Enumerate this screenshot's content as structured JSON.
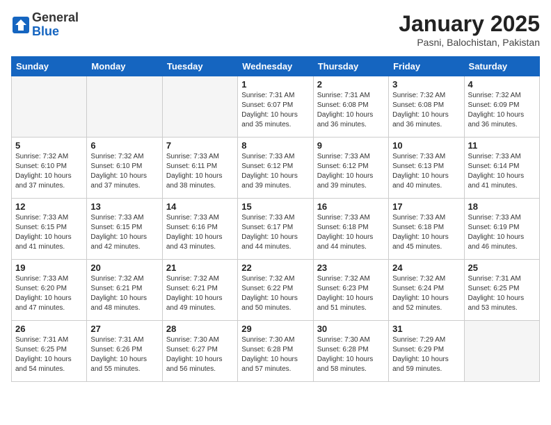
{
  "header": {
    "logo_line1": "General",
    "logo_line2": "Blue",
    "title": "January 2025",
    "subtitle": "Pasni, Balochistan, Pakistan"
  },
  "weekdays": [
    "Sunday",
    "Monday",
    "Tuesday",
    "Wednesday",
    "Thursday",
    "Friday",
    "Saturday"
  ],
  "weeks": [
    [
      {
        "day": "",
        "empty": true
      },
      {
        "day": "",
        "empty": true
      },
      {
        "day": "",
        "empty": true
      },
      {
        "day": "1",
        "sunrise": "7:31 AM",
        "sunset": "6:07 PM",
        "daylight": "10 hours and 35 minutes."
      },
      {
        "day": "2",
        "sunrise": "7:31 AM",
        "sunset": "6:08 PM",
        "daylight": "10 hours and 36 minutes."
      },
      {
        "day": "3",
        "sunrise": "7:32 AM",
        "sunset": "6:08 PM",
        "daylight": "10 hours and 36 minutes."
      },
      {
        "day": "4",
        "sunrise": "7:32 AM",
        "sunset": "6:09 PM",
        "daylight": "10 hours and 36 minutes."
      }
    ],
    [
      {
        "day": "5",
        "sunrise": "7:32 AM",
        "sunset": "6:10 PM",
        "daylight": "10 hours and 37 minutes."
      },
      {
        "day": "6",
        "sunrise": "7:32 AM",
        "sunset": "6:10 PM",
        "daylight": "10 hours and 37 minutes."
      },
      {
        "day": "7",
        "sunrise": "7:33 AM",
        "sunset": "6:11 PM",
        "daylight": "10 hours and 38 minutes."
      },
      {
        "day": "8",
        "sunrise": "7:33 AM",
        "sunset": "6:12 PM",
        "daylight": "10 hours and 39 minutes."
      },
      {
        "day": "9",
        "sunrise": "7:33 AM",
        "sunset": "6:12 PM",
        "daylight": "10 hours and 39 minutes."
      },
      {
        "day": "10",
        "sunrise": "7:33 AM",
        "sunset": "6:13 PM",
        "daylight": "10 hours and 40 minutes."
      },
      {
        "day": "11",
        "sunrise": "7:33 AM",
        "sunset": "6:14 PM",
        "daylight": "10 hours and 41 minutes."
      }
    ],
    [
      {
        "day": "12",
        "sunrise": "7:33 AM",
        "sunset": "6:15 PM",
        "daylight": "10 hours and 41 minutes."
      },
      {
        "day": "13",
        "sunrise": "7:33 AM",
        "sunset": "6:15 PM",
        "daylight": "10 hours and 42 minutes."
      },
      {
        "day": "14",
        "sunrise": "7:33 AM",
        "sunset": "6:16 PM",
        "daylight": "10 hours and 43 minutes."
      },
      {
        "day": "15",
        "sunrise": "7:33 AM",
        "sunset": "6:17 PM",
        "daylight": "10 hours and 44 minutes."
      },
      {
        "day": "16",
        "sunrise": "7:33 AM",
        "sunset": "6:18 PM",
        "daylight": "10 hours and 44 minutes."
      },
      {
        "day": "17",
        "sunrise": "7:33 AM",
        "sunset": "6:18 PM",
        "daylight": "10 hours and 45 minutes."
      },
      {
        "day": "18",
        "sunrise": "7:33 AM",
        "sunset": "6:19 PM",
        "daylight": "10 hours and 46 minutes."
      }
    ],
    [
      {
        "day": "19",
        "sunrise": "7:33 AM",
        "sunset": "6:20 PM",
        "daylight": "10 hours and 47 minutes."
      },
      {
        "day": "20",
        "sunrise": "7:32 AM",
        "sunset": "6:21 PM",
        "daylight": "10 hours and 48 minutes."
      },
      {
        "day": "21",
        "sunrise": "7:32 AM",
        "sunset": "6:21 PM",
        "daylight": "10 hours and 49 minutes."
      },
      {
        "day": "22",
        "sunrise": "7:32 AM",
        "sunset": "6:22 PM",
        "daylight": "10 hours and 50 minutes."
      },
      {
        "day": "23",
        "sunrise": "7:32 AM",
        "sunset": "6:23 PM",
        "daylight": "10 hours and 51 minutes."
      },
      {
        "day": "24",
        "sunrise": "7:32 AM",
        "sunset": "6:24 PM",
        "daylight": "10 hours and 52 minutes."
      },
      {
        "day": "25",
        "sunrise": "7:31 AM",
        "sunset": "6:25 PM",
        "daylight": "10 hours and 53 minutes."
      }
    ],
    [
      {
        "day": "26",
        "sunrise": "7:31 AM",
        "sunset": "6:25 PM",
        "daylight": "10 hours and 54 minutes."
      },
      {
        "day": "27",
        "sunrise": "7:31 AM",
        "sunset": "6:26 PM",
        "daylight": "10 hours and 55 minutes."
      },
      {
        "day": "28",
        "sunrise": "7:30 AM",
        "sunset": "6:27 PM",
        "daylight": "10 hours and 56 minutes."
      },
      {
        "day": "29",
        "sunrise": "7:30 AM",
        "sunset": "6:28 PM",
        "daylight": "10 hours and 57 minutes."
      },
      {
        "day": "30",
        "sunrise": "7:30 AM",
        "sunset": "6:28 PM",
        "daylight": "10 hours and 58 minutes."
      },
      {
        "day": "31",
        "sunrise": "7:29 AM",
        "sunset": "6:29 PM",
        "daylight": "10 hours and 59 minutes."
      },
      {
        "day": "",
        "empty": true
      }
    ]
  ]
}
